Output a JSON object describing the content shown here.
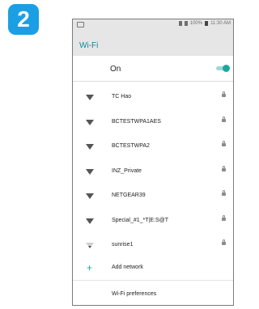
{
  "step": "2",
  "status_bar": {
    "battery_text": "100%",
    "time": "11:30 AM"
  },
  "screen": {
    "title": "Wi-Fi",
    "toggle_label": "On",
    "networks": [
      {
        "name": "TC Hao",
        "signal": "strong",
        "locked": true
      },
      {
        "name": "BCTESTWPA1AES",
        "signal": "strong",
        "locked": true
      },
      {
        "name": "BCTESTWPA2",
        "signal": "strong",
        "locked": true
      },
      {
        "name": "INZ_Private",
        "signal": "strong",
        "locked": true
      },
      {
        "name": "NETGEAR39",
        "signal": "strong",
        "locked": true
      },
      {
        "name": "Special_#1_*T|E:S@T",
        "signal": "strong",
        "locked": true
      },
      {
        "name": "sunrise1",
        "signal": "weak",
        "locked": true
      }
    ],
    "add_network": "Add network",
    "preferences": "Wi-Fi preferences"
  },
  "colors": {
    "badge": "#1b9fe4",
    "accent": "#1aa89e",
    "header_bg": "#e6e6e6"
  }
}
